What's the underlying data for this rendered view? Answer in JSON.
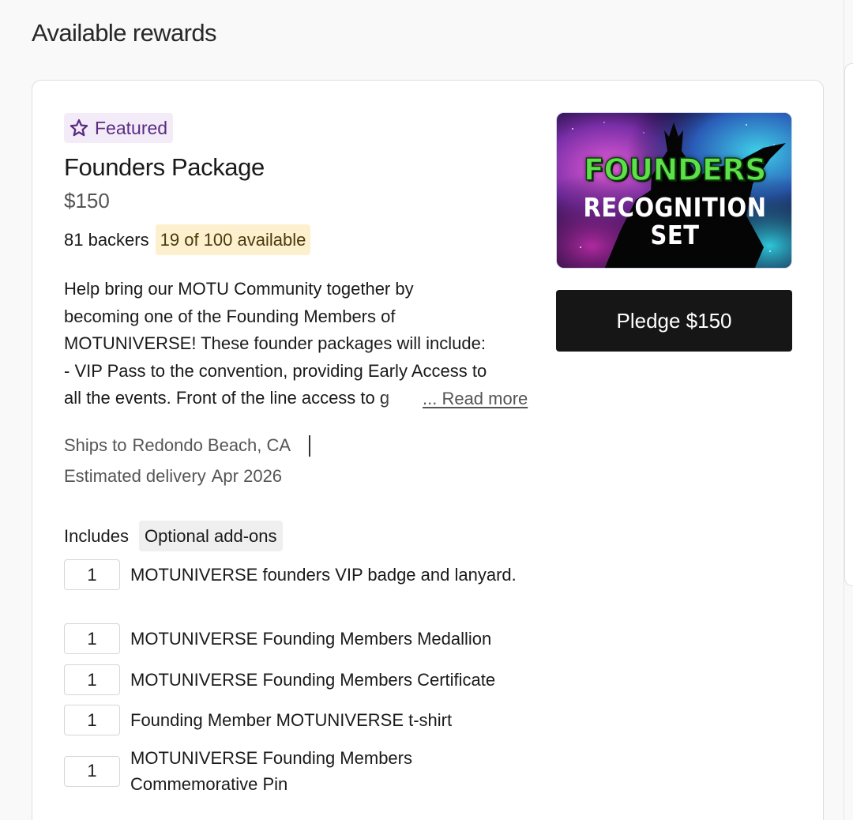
{
  "section": {
    "title": "Available rewards"
  },
  "reward": {
    "badge": {
      "label": "Featured",
      "icon": "star-icon",
      "color": "#5a2b82",
      "background": "#f3ecf8"
    },
    "title": "Founders Package",
    "price": "$150",
    "backers": "81 backers",
    "availability": "19 of 100 available",
    "description": "Help bring our MOTU Community together by\nbecoming one of the Founding Members of\nMOTUNIVERSE! These founder packages will include:\n- VIP Pass to the convention, providing Early Access to\nall the events. Front of the line access to g",
    "read_more": "... Read more",
    "ships_label": "Ships to",
    "ships_value": "Redondo Beach, CA",
    "delivery_label": "Estimated delivery",
    "delivery_value": "Apr 2026",
    "includes_label": "Includes",
    "addons_label": "Optional add-ons",
    "items": [
      {
        "qty": "1",
        "name": "MOTUNIVERSE founders VIP badge and lanyard."
      },
      {
        "qty": "1",
        "name": "MOTUNIVERSE Founding Members Medallion"
      },
      {
        "qty": "1",
        "name": "MOTUNIVERSE Founding Members Certificate"
      },
      {
        "qty": "1",
        "name": "Founding Member MOTUNIVERSE t-shirt"
      },
      {
        "qty": "1",
        "name": "MOTUNIVERSE Founding Members Commemorative Pin"
      }
    ],
    "image": {
      "line1": "FOUNDERS",
      "line2": "RECOGNITION",
      "line3": "SET"
    },
    "pledge_button": "Pledge $150"
  },
  "colors": {
    "page_background": "#f9f9f9",
    "card_background": "#ffffff",
    "availability_background": "#fdf0cf",
    "addons_background": "#efefef",
    "button_background": "#161616",
    "button_text": "#ffffff"
  }
}
